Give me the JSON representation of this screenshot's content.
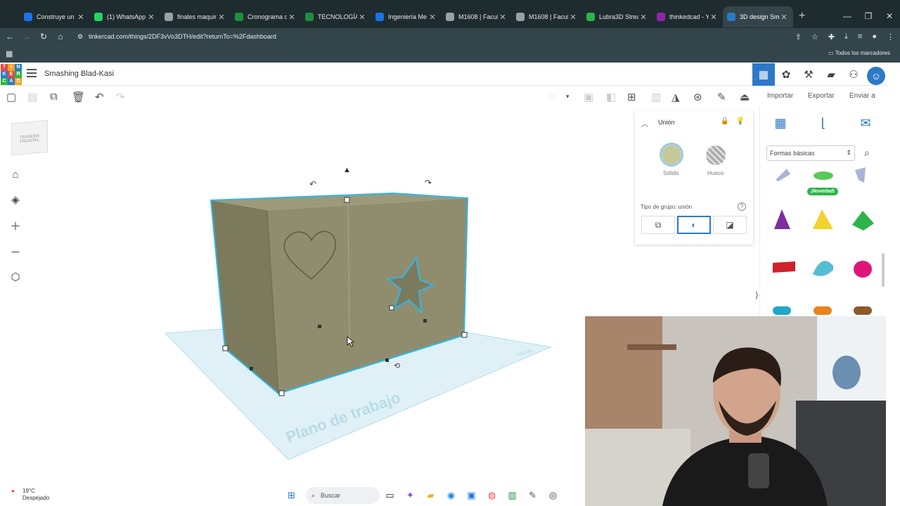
{
  "browser": {
    "tabs": [
      {
        "title": "Construye un ",
        "color": "#1a73e8"
      },
      {
        "title": "(1) WhatsApp",
        "color": "#25d366"
      },
      {
        "title": "finales maquin",
        "color": "#9aa0a6"
      },
      {
        "title": "Cronograma d",
        "color": "#1e8e3e"
      },
      {
        "title": "TECNOLOGÍAS",
        "color": "#1e8e3e"
      },
      {
        "title": "Ingeniería Me",
        "color": "#1a73e8"
      },
      {
        "title": "M1608 | Facult",
        "color": "#9aa0a6"
      },
      {
        "title": "M1608 | Facult",
        "color": "#9aa0a6"
      },
      {
        "title": "Lubra3D Strea",
        "color": "#2db34a"
      },
      {
        "title": "thinkedcad - Y",
        "color": "#8e24aa"
      },
      {
        "title": "3D design Sm",
        "color": "#2d79c7",
        "active": true
      }
    ],
    "new_tab": "+",
    "url": "tinkercad.com/things/2DF3vVo3DTH/edit?returnTo=%2Fdashboard",
    "bookmarks_label": "Todos los marcadores"
  },
  "app": {
    "logo_letters": [
      "T",
      "I",
      "N",
      "K",
      "E",
      "R",
      "C",
      "A",
      "D"
    ],
    "logo_colors": [
      "#e9473f",
      "#f5a623",
      "#2d79c7",
      "#2d79c7",
      "#e9473f",
      "#2db34a",
      "#2db34a",
      "#2d79c7",
      "#f5a623"
    ],
    "design_title": "Smashing Blad-Kasi",
    "import_label": "Importar",
    "export_label": "Exportar",
    "send_label": "Enviar a"
  },
  "viewcube": {
    "label": "TRASERA FRONTAL"
  },
  "workplane": {
    "label": "Plano de trabajo",
    "corner_label": "Mbordo"
  },
  "inspector": {
    "title": "Unión",
    "solid_label": "Sólido",
    "hole_label": "Hueco",
    "group_type_label": "Tipo de grupo: unión",
    "help": "?"
  },
  "shapes_panel": {
    "category": "Formas básicas",
    "new_badge": "¡Novedad!"
  },
  "taskbar": {
    "weather_temp": "19°C",
    "weather_desc": "Despejado",
    "search_placeholder": "Buscar"
  },
  "colors": {
    "accent": "#2d79c7",
    "box_fill": "#8f8d6e",
    "selection": "#2fb8e6",
    "workplane": "#dff1f7"
  }
}
